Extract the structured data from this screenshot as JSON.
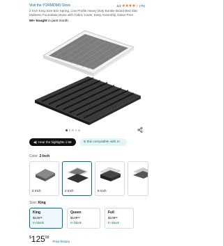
{
  "store": {
    "link": "Visit the YORMDMO Store"
  },
  "rating": {
    "value": "4.2",
    "stars": "★★★★☆",
    "count": "(76)"
  },
  "product": {
    "title": "2 Inch King Size Box Spring, Low Profile Heavy Duty Bunkie Board Bed Slat Mattress Foundation Base with Fabric Cover, Easy Assembly, Noise-Free",
    "bought": "50+ bought",
    "bought_suffix": " in past month"
  },
  "carousel": {
    "image_count": 5,
    "active_index": 0
  },
  "actions": {
    "highlights_label": "Hear the highlights 1:58",
    "compatible_label": "Is this compatible with m"
  },
  "color": {
    "label": "Color:",
    "selected": "2 Inch",
    "options": [
      {
        "label": "4 Inch"
      },
      {
        "label": "2 Inch"
      },
      {
        "label": "8 Inch"
      },
      {
        "label": ""
      }
    ]
  },
  "size": {
    "label": "Size:",
    "selected": "King",
    "options": [
      {
        "name": "King",
        "dollars": "$125",
        "cents": "99",
        "stock": "In Stock"
      },
      {
        "name": "Queen",
        "dollars": "$109",
        "cents": "99",
        "stock": "In Stock"
      },
      {
        "name": "Full",
        "dollars": "$109",
        "cents": "99",
        "stock": "In Stock"
      }
    ]
  },
  "price": {
    "symbol": "$",
    "whole": "125",
    "fraction": "99",
    "history_label": "Price history"
  },
  "colors": {
    "link": "#007185",
    "accent": "#de7921",
    "in_stock": "#007600",
    "selected_border": "#007185"
  }
}
